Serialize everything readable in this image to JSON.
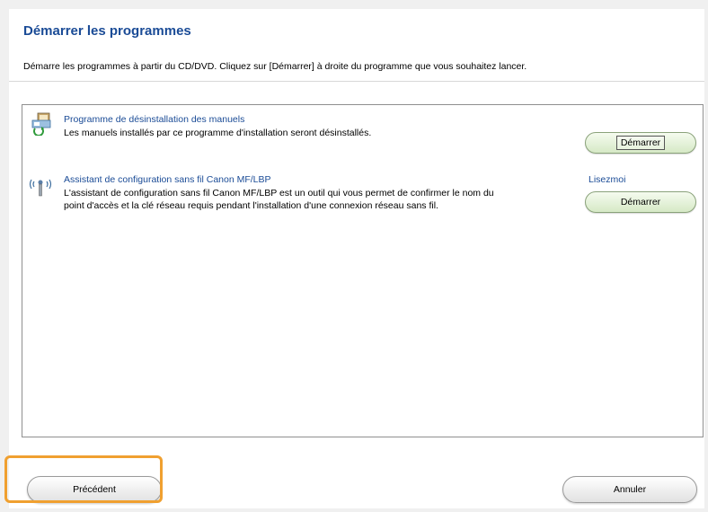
{
  "header": {
    "title": "Démarrer les programmes",
    "description": "Démarre les programmes à partir du CD/DVD. Cliquez sur [Démarrer] à droite du programme que vous souhaitez lancer."
  },
  "programs": [
    {
      "title": "Programme de désinstallation des manuels",
      "description": "Les manuels installés par ce programme d'installation seront désinstallés.",
      "start_label": "Démarrer",
      "icon": "uninstall-manuals-icon"
    },
    {
      "title": "Assistant de configuration sans fil Canon MF/LBP",
      "description_line1": "L'assistant de configuration sans fil Canon MF/LBP est un outil qui vous permet de confirmer le nom du",
      "description_line2": "point d'accès et la clé réseau requis pendant l'installation d'une connexion réseau sans fil.",
      "readme_label": "Lisezmoi",
      "start_label": "Démarrer",
      "icon": "wireless-antenna-icon"
    }
  ],
  "footer": {
    "back_label": "Précédent",
    "cancel_label": "Annuler"
  },
  "colors": {
    "link": "#1a4b96",
    "highlight": "#f0a030",
    "start_button": "#d6e9c6"
  }
}
